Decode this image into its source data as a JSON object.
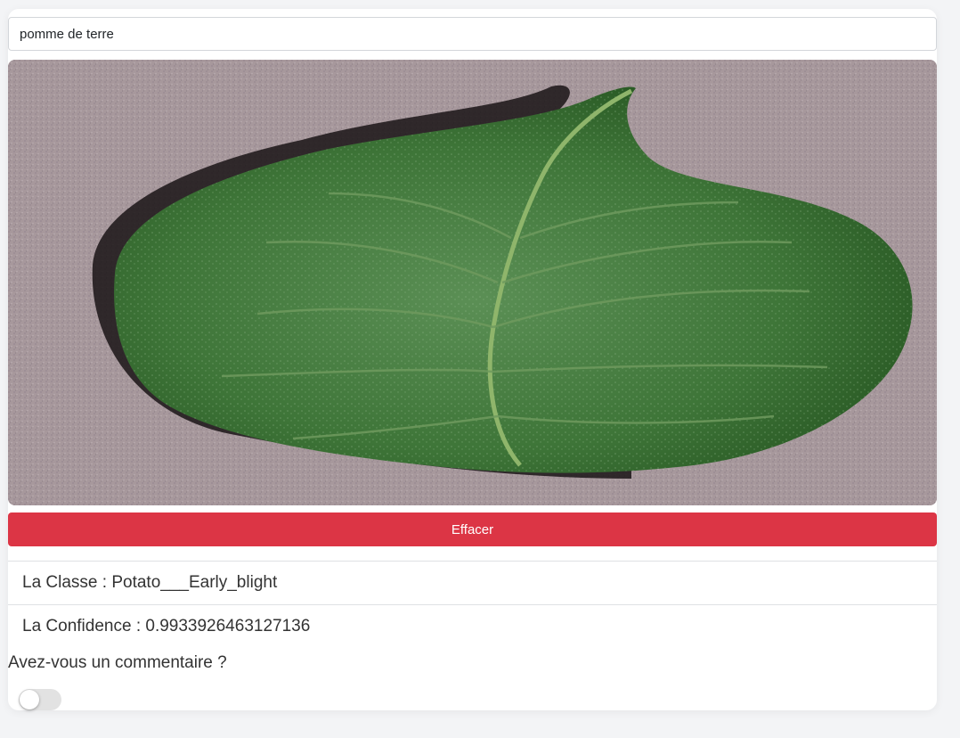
{
  "form": {
    "plant_input_value": "pomme de terre",
    "image_alt": "uploaded leaf photo",
    "clear_button_label": "Effacer"
  },
  "results": {
    "class_text": "La Classe : Potato___Early_blight",
    "confidence_text": "La Confidence : 0.9933926463127136"
  },
  "comment": {
    "question": "Avez-vous un commentaire ?",
    "toggle_on": false
  },
  "colors": {
    "clear_button": "#dc3545",
    "background": "#f3f4f6",
    "leaf": "#3f7a3c",
    "surface": "#a7989c"
  },
  "icons": {
    "toggle": "toggle-switch-icon"
  }
}
